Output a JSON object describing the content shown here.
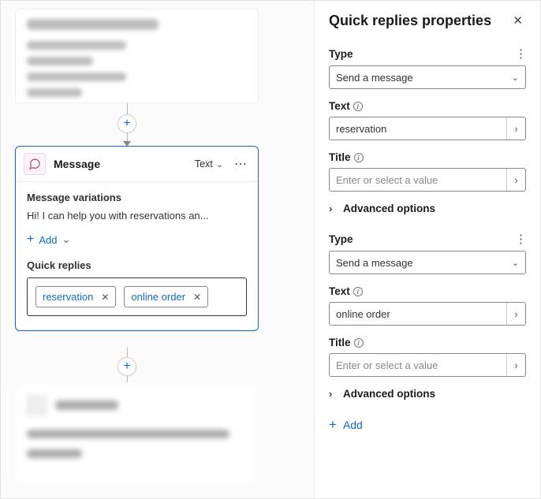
{
  "panel": {
    "title": "Quick replies properties",
    "groups": [
      {
        "type_label": "Type",
        "type_value": "Send a message",
        "text_label": "Text",
        "text_value": "reservation",
        "title_label": "Title",
        "title_placeholder": "Enter or select a value",
        "advanced_label": "Advanced options"
      },
      {
        "type_label": "Type",
        "type_value": "Send a message",
        "text_label": "Text",
        "text_value": "online order",
        "title_label": "Title",
        "title_placeholder": "Enter or select a value",
        "advanced_label": "Advanced options"
      }
    ],
    "add_label": "Add"
  },
  "node": {
    "title": "Message",
    "mode": "Text",
    "variations_label": "Message variations",
    "variation_text": "Hi! I can help you with reservations an...",
    "add_label": "Add",
    "quick_replies_label": "Quick replies",
    "chips": {
      "0": "reservation",
      "1": "online order"
    }
  }
}
